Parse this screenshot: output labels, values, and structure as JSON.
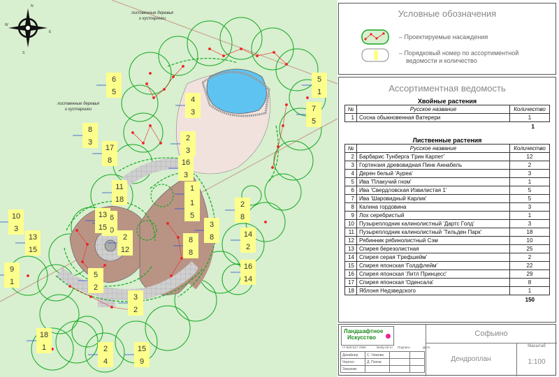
{
  "plan": {
    "label_trees_top": [
      "лиственные деревья",
      "и кустарники"
    ],
    "label_trees_left": [
      "лиственные деревья",
      "и кустарники"
    ],
    "compass": {
      "n": "N",
      "s": "S",
      "e": "E",
      "w": "W"
    },
    "callouts": [
      {
        "top": "6",
        "bottom": "5"
      },
      {
        "top": "4",
        "bottom": "3"
      },
      {
        "top": "2",
        "bottom": "3"
      },
      {
        "top": "8",
        "bottom": "3"
      },
      {
        "top": "17",
        "bottom": "8"
      },
      {
        "top": "16",
        "bottom": "3"
      },
      {
        "top": "11",
        "bottom": "18"
      },
      {
        "top": "1",
        "bottom": "3"
      },
      {
        "top": "1",
        "bottom": "5"
      },
      {
        "top": "10",
        "bottom": "3"
      },
      {
        "top": "13",
        "bottom": "15"
      },
      {
        "top": "16",
        "bottom": "10"
      },
      {
        "top": "2",
        "bottom": "12"
      },
      {
        "top": "3",
        "bottom": "8"
      },
      {
        "top": "2",
        "bottom": "8"
      },
      {
        "top": "5",
        "bottom": "1"
      },
      {
        "top": "7",
        "bottom": "5"
      },
      {
        "top": "14",
        "bottom": "2"
      },
      {
        "top": "16",
        "bottom": "14"
      },
      {
        "top": "9",
        "bottom": "1"
      },
      {
        "top": "18",
        "bottom": "1"
      },
      {
        "top": "2",
        "bottom": "4"
      },
      {
        "top": "15",
        "bottom": "9"
      },
      {
        "top": "3",
        "bottom": "2"
      },
      {
        "top": "5",
        "bottom": "2"
      },
      {
        "top": "13",
        "bottom": "15"
      },
      {
        "top": "8",
        "bottom": "8"
      }
    ]
  },
  "legend": {
    "title": "Условные обозначения",
    "item1": "– Проектируемые насаждения",
    "item2_line1": "– Порядковый номер по ассортиментной",
    "item2_line2": "ведомости и количество"
  },
  "assortment": {
    "title": "Ассортиментная ведомость",
    "conifer_title": "Хвойные растения",
    "deciduous_title": "Лиственные растения",
    "headers": {
      "no": "№",
      "name": "Русское название",
      "qty": "Количество"
    },
    "conifers": [
      {
        "no": "1",
        "name": "Сосна обыкновенная Ватерери",
        "qty": "1"
      }
    ],
    "conifer_total": "1",
    "deciduous": [
      {
        "no": "2",
        "name": "Барбарис Тунберга 'Грин Карпет'",
        "qty": "12"
      },
      {
        "no": "3",
        "name": "Гортензия древовидная Пинк Аннабель",
        "qty": "2"
      },
      {
        "no": "4",
        "name": "Дерен белый 'Ауреа'",
        "qty": "3"
      },
      {
        "no": "5",
        "name": "Ива 'Плакучий гном'",
        "qty": "1"
      },
      {
        "no": "6",
        "name": "Ива 'Свердловская Извилистая 1'",
        "qty": "5"
      },
      {
        "no": "7",
        "name": "Ива 'Шаровидный Карлик'",
        "qty": "5"
      },
      {
        "no": "8",
        "name": "Калина гордовина",
        "qty": "3"
      },
      {
        "no": "9",
        "name": "Лох серебристый",
        "qty": "1"
      },
      {
        "no": "10",
        "name": "Пузыреплодник калинолистный 'Дартс Голд'",
        "qty": "3"
      },
      {
        "no": "11",
        "name": "Пузыреплодник калинолистный 'Тильден Парк'",
        "qty": "18"
      },
      {
        "no": "12",
        "name": "Рябинник рябинолистный Сэм",
        "qty": "10"
      },
      {
        "no": "13",
        "name": "Спирея березолистная",
        "qty": "25"
      },
      {
        "no": "14",
        "name": "Спирея серая 'Грефшейм'",
        "qty": "2"
      },
      {
        "no": "15",
        "name": "Спирея японская 'Голдфлейм'",
        "qty": "22"
      },
      {
        "no": "16",
        "name": "Спирея японская 'Литл Принцесс'",
        "qty": "29"
      },
      {
        "no": "17",
        "name": "Спирея японская 'Оденсала'",
        "qty": "8"
      },
      {
        "no": "18",
        "name": "Яблоня Недзведского",
        "qty": "1"
      }
    ],
    "deciduous_total": "150"
  },
  "stamp": {
    "logo_line1": "Ландшафтное",
    "logo_line2": "Искусство",
    "phone": "+7-925-517-7666",
    "site": "landy-art.ru",
    "col_sign": "Подпись",
    "col_date": "Дата",
    "row1_role": "Дизайнер",
    "row1_name": "С. Чижова",
    "row2_role": "Чертил",
    "row2_name": "Д. Попов",
    "row3_role": "Заказчик",
    "project": "Софьино",
    "sheet": "Дендроплан",
    "scale_label": "Масштаб",
    "scale": "1:100"
  },
  "colors": {
    "lawn": "#d8efd0",
    "paving": "#b99485",
    "paving_grey": "#c8c8c8",
    "water": "#5fc3f2",
    "hedge": "#13a81f",
    "dot": "#ee2222",
    "callout": "#fdff8c",
    "patio": "#f2e2dd"
  }
}
